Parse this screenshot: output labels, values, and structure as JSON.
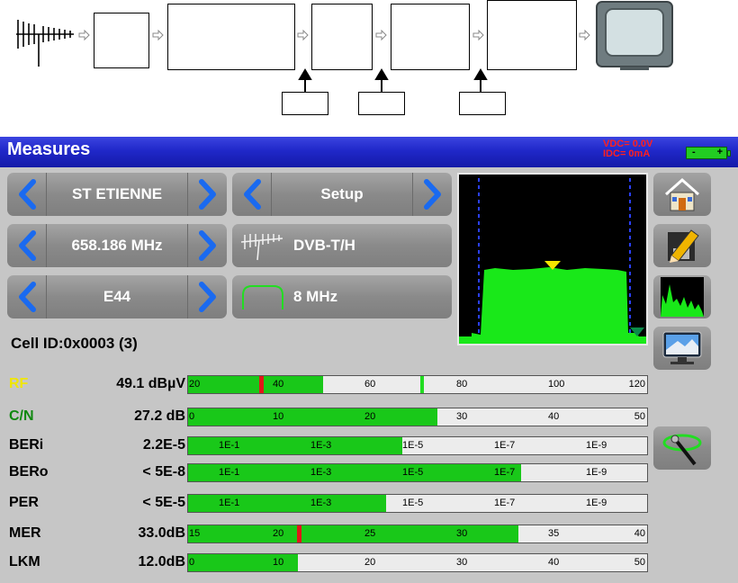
{
  "screen": {
    "title": "Measures",
    "vdc": "VDC= 0.0V",
    "idc": "IDC=  0mA",
    "battery_minus": "-",
    "battery_plus": "+",
    "colors": {
      "titlebar": "#2028c9",
      "fill": "#19c819",
      "marker": "#e01818",
      "rf_label": "#f0e600",
      "cn_label": "#108810"
    },
    "selectors": {
      "channel": "ST ETIENNE",
      "mode": "Setup",
      "frequency": "658.186 MHz",
      "standard": "DVB-T/H",
      "channel_number": "E44",
      "bandwidth": "8 MHz"
    },
    "icons": [
      "home-icon",
      "save-edit-icon",
      "spectrum-icon",
      "tv-monitor-icon",
      "satellite-pointer-icon"
    ],
    "cell_id": "Cell ID:0x0003 (3)"
  },
  "measures": [
    {
      "name": "RF",
      "value": "49.1 dBµV",
      "ticks": [
        "20",
        "40",
        "60",
        "80",
        "100",
        "120"
      ],
      "fill": 0.294,
      "marker": 0.154,
      "marker2": 0.505
    },
    {
      "name": "C/N",
      "value": "27.2 dB",
      "ticks": [
        "0",
        "10",
        "20",
        "30",
        "40",
        "50"
      ],
      "fill": 0.544
    },
    {
      "name": "BERi",
      "value": "2.2E-5",
      "ticks": [
        "1E-1",
        "1E-3",
        "1E-5",
        "1E-7",
        "1E-9"
      ],
      "fill": 0.466
    },
    {
      "name": "BERo",
      "value": "< 5E-8",
      "ticks": [
        "1E-1",
        "1E-3",
        "1E-5",
        "1E-7",
        "1E-9"
      ],
      "fill": 0.726
    },
    {
      "name": "PER",
      "value": "< 5E-5",
      "ticks": [
        "1E-1",
        "1E-3",
        "1E-5",
        "1E-7",
        "1E-9"
      ],
      "fill": 0.432
    },
    {
      "name": "MER",
      "value": "33.0dB",
      "ticks": [
        "15",
        "20",
        "25",
        "30",
        "35",
        "40"
      ],
      "fill": 0.72,
      "marker": 0.238
    },
    {
      "name": "LKM",
      "value": "12.0dB",
      "ticks": [
        "0",
        "10",
        "20",
        "30",
        "40",
        "50"
      ],
      "fill": 0.24
    }
  ]
}
